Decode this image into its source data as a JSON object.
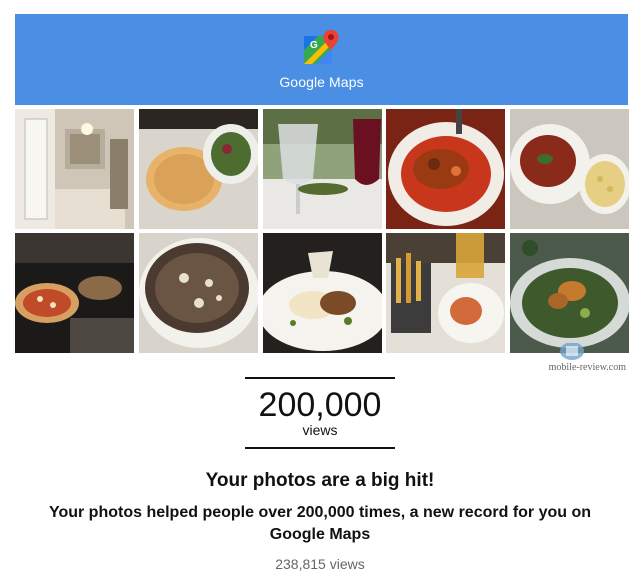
{
  "header": {
    "brand_name": "Google Maps",
    "logo_icon": "google-maps-pin-icon",
    "background_color": "#4a8fe3"
  },
  "photos": [
    {
      "icon": "restaurant-interior-photo"
    },
    {
      "icon": "rice-and-salad-photo"
    },
    {
      "icon": "wine-glasses-photo"
    },
    {
      "icon": "stewed-dish-photo"
    },
    {
      "icon": "soup-and-pasta-photo"
    },
    {
      "icon": "pizza-oven-photo"
    },
    {
      "icon": "pizza-with-mushrooms-photo"
    },
    {
      "icon": "plated-meat-dish-photo"
    },
    {
      "icon": "fries-and-beer-photo"
    },
    {
      "icon": "salad-bowl-photo"
    }
  ],
  "watermark": {
    "text": "mobile-review.com"
  },
  "stat": {
    "value": "200,000",
    "unit": "views"
  },
  "message": {
    "headline": "Your photos are a big hit!",
    "body": "Your photos helped people over 200,000 times, a new record for you on Google Maps"
  },
  "total_views": "238,815 views"
}
